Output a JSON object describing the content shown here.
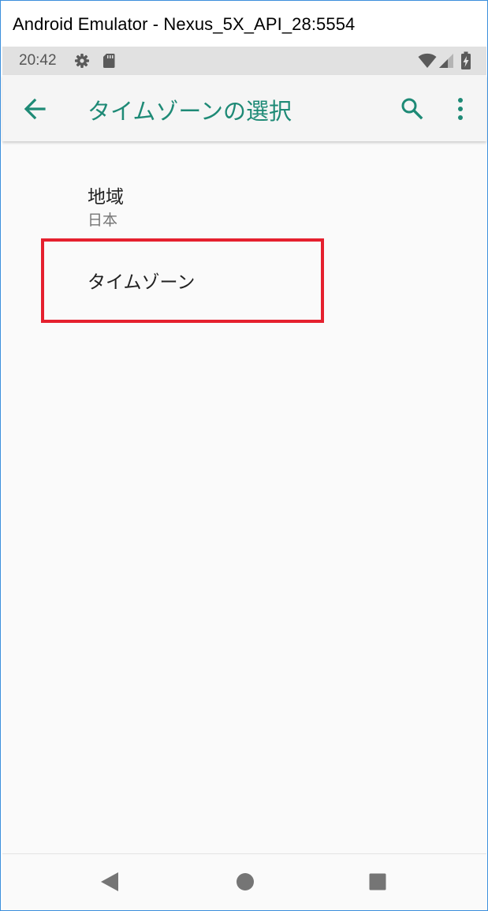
{
  "window": {
    "title": "Android Emulator - Nexus_5X_API_28:5554"
  },
  "status_bar": {
    "time": "20:42",
    "icons": [
      "settings-gear-icon",
      "sd-card-icon",
      "wifi-icon",
      "cellular-signal-icon",
      "battery-charging-icon"
    ]
  },
  "app_bar": {
    "title": "タイムゾーンの選択",
    "accent_color": "#1e8a76",
    "icons": [
      "back-arrow-icon",
      "search-icon",
      "more-vert-icon"
    ]
  },
  "preferences": [
    {
      "title": "地域",
      "summary": "日本"
    },
    {
      "title": "タイムゾーン",
      "highlighted": true
    }
  ],
  "highlight_color": "#e5202e",
  "nav_bar": {
    "icons": [
      "back-triangle-icon",
      "home-circle-icon",
      "recents-square-icon"
    ]
  }
}
